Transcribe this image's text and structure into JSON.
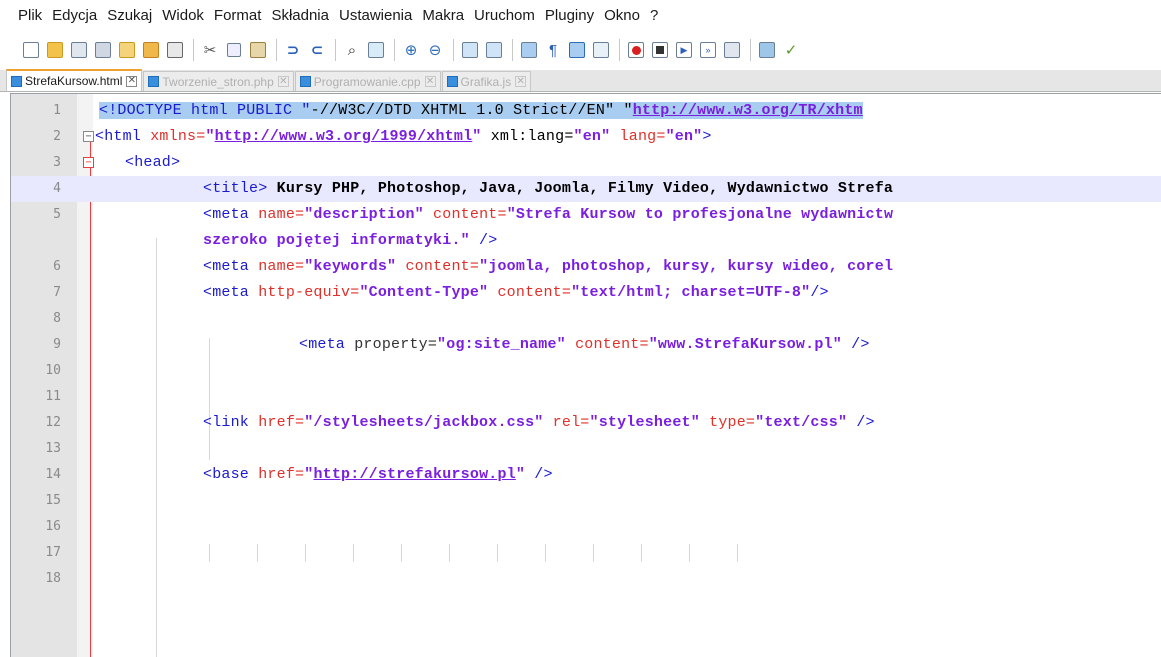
{
  "menu": [
    "Plik",
    "Edycja",
    "Szukaj",
    "Widok",
    "Format",
    "Składnia",
    "Ustawienia",
    "Makra",
    "Uruchom",
    "Pluginy",
    "Okno",
    "?"
  ],
  "tabs": [
    {
      "label": "StrefaKursow.html",
      "active": true
    },
    {
      "label": "Tworzenie_stron.php",
      "active": false
    },
    {
      "label": "Programowanie.cpp",
      "active": false
    },
    {
      "label": "Grafika.js",
      "active": false
    }
  ],
  "line_numbers": [
    "1",
    "2",
    "3",
    "4",
    "5",
    "6",
    "7",
    "8",
    "9",
    "10",
    "11",
    "12",
    "13",
    "14",
    "15",
    "16",
    "17",
    "18"
  ],
  "code": {
    "l1_a": "<!DOCTYPE html PUBLIC \"",
    "l1_b": "-//W3C//DTD XHTML 1.0 Strict//EN",
    "l1_c": "\" \"",
    "l1_d": "http://www.w3.org/TR/xhtm",
    "l2_open": "<html ",
    "l2_attr1": "xmlns=",
    "l2_q1": "\"",
    "l2_url": "http://www.w3.org/1999/xhtml",
    "l2_q2": "\" ",
    "l2_attr2": "xml:lang=",
    "l2_v2": "\"en\"",
    "l2_attr3": " lang=",
    "l2_v3": "\"en\"",
    "l2_close": ">",
    "l3": "<head>",
    "l4_tag": "<title>",
    "l4_text": " Kursy PHP, Photoshop, Java, Joomla, Filmy Video, Wydawnictwo Strefa",
    "l5_tag": "<meta ",
    "l5_attr1": "name=",
    "l5_v1": "\"description\"",
    "l5_attr2": " content=",
    "l5_v2": "\"Strefa Kursow to profesjonalne wydawnictw",
    "l5_wrap": "szeroko pojętej informatyki.\"",
    "l5_close": " />",
    "l6_tag": "<meta ",
    "l6_attr1": "name=",
    "l6_v1": "\"keywords\"",
    "l6_attr2": " content=",
    "l6_v2": "\"joomla, photoshop, kursy, kursy wideo, corel",
    "l7_tag": "<meta ",
    "l7_attr1": "http-equiv=",
    "l7_v1": "\"Content-Type\"",
    "l7_attr2": " content=",
    "l7_v2": "\"text/html; charset=UTF-8\"",
    "l7_close": "/>",
    "l9_tag": "<meta ",
    "l9_attr1": "property=",
    "l9_v1": "\"og:site_name\"",
    "l9_attr2": " content=",
    "l9_v2": "\"www.StrefaKursow.pl\"",
    "l9_close": " />",
    "l12_tag": "<link ",
    "l12_attr1": "href=",
    "l12_v1": "\"/stylesheets/jackbox.css\"",
    "l12_attr2": " rel=",
    "l12_v2": "\"stylesheet\"",
    "l12_attr3": " type=",
    "l12_v3": "\"text/css\"",
    "l12_close": " />",
    "l14_tag": "<base ",
    "l14_attr1": "href=",
    "l14_q1": "\"",
    "l14_url": "http://strefakursow.pl",
    "l14_q2": "\"",
    "l14_close": " />"
  },
  "colors": {
    "tag": "#1a1ad0",
    "attribute": "#e0302a",
    "string": "#7a1ee0",
    "selection": "#a8cdf0",
    "current_line": "#e8e8ff",
    "fold_marker": "#e84040"
  }
}
